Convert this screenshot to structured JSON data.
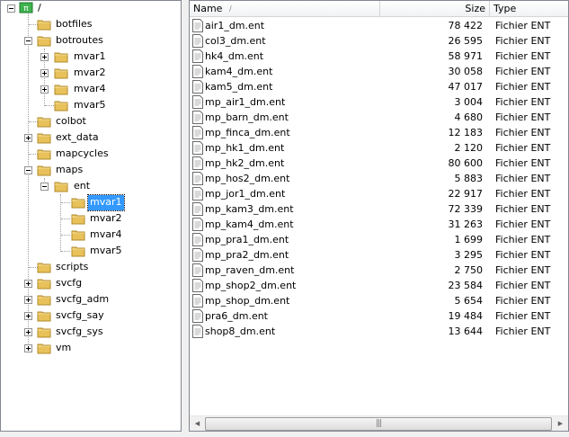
{
  "tree": {
    "root_label": "/",
    "items": [
      {
        "label": "botfiles"
      },
      {
        "label": "botroutes"
      },
      {
        "label": "mvar1"
      },
      {
        "label": "mvar2"
      },
      {
        "label": "mvar4"
      },
      {
        "label": "mvar5"
      },
      {
        "label": "colbot"
      },
      {
        "label": "ext_data"
      },
      {
        "label": "mapcycles"
      },
      {
        "label": "maps"
      },
      {
        "label": "ent"
      },
      {
        "label": "mvar1"
      },
      {
        "label": "mvar2"
      },
      {
        "label": "mvar4"
      },
      {
        "label": "mvar5"
      },
      {
        "label": "scripts"
      },
      {
        "label": "svcfg"
      },
      {
        "label": "svcfg_adm"
      },
      {
        "label": "svcfg_say"
      },
      {
        "label": "svcfg_sys"
      },
      {
        "label": "vm"
      }
    ],
    "selected_item": "mvar1"
  },
  "list": {
    "columns": {
      "name": "Name",
      "size": "Size",
      "type": "Type"
    },
    "files": [
      {
        "name": "air1_dm.ent",
        "size": "78 422",
        "type": "Fichier ENT"
      },
      {
        "name": "col3_dm.ent",
        "size": "26 595",
        "type": "Fichier ENT"
      },
      {
        "name": "hk4_dm.ent",
        "size": "58 971",
        "type": "Fichier ENT"
      },
      {
        "name": "kam4_dm.ent",
        "size": "30 058",
        "type": "Fichier ENT"
      },
      {
        "name": "kam5_dm.ent",
        "size": "47 017",
        "type": "Fichier ENT"
      },
      {
        "name": "mp_air1_dm.ent",
        "size": "3 004",
        "type": "Fichier ENT"
      },
      {
        "name": "mp_barn_dm.ent",
        "size": "4 680",
        "type": "Fichier ENT"
      },
      {
        "name": "mp_finca_dm.ent",
        "size": "12 183",
        "type": "Fichier ENT"
      },
      {
        "name": "mp_hk1_dm.ent",
        "size": "2 120",
        "type": "Fichier ENT"
      },
      {
        "name": "mp_hk2_dm.ent",
        "size": "80 600",
        "type": "Fichier ENT"
      },
      {
        "name": "mp_hos2_dm.ent",
        "size": "5 883",
        "type": "Fichier ENT"
      },
      {
        "name": "mp_jor1_dm.ent",
        "size": "22 917",
        "type": "Fichier ENT"
      },
      {
        "name": "mp_kam3_dm.ent",
        "size": "72 339",
        "type": "Fichier ENT"
      },
      {
        "name": "mp_kam4_dm.ent",
        "size": "31 263",
        "type": "Fichier ENT"
      },
      {
        "name": "mp_pra1_dm.ent",
        "size": "1 699",
        "type": "Fichier ENT"
      },
      {
        "name": "mp_pra2_dm.ent",
        "size": "3 295",
        "type": "Fichier ENT"
      },
      {
        "name": "mp_raven_dm.ent",
        "size": "2 750",
        "type": "Fichier ENT"
      },
      {
        "name": "mp_shop2_dm.ent",
        "size": "23 584",
        "type": "Fichier ENT"
      },
      {
        "name": "mp_shop_dm.ent",
        "size": "5 654",
        "type": "Fichier ENT"
      },
      {
        "name": "pra6_dm.ent",
        "size": "19 484",
        "type": "Fichier ENT"
      },
      {
        "name": "shop8_dm.ent",
        "size": "13 644",
        "type": "Fichier ENT"
      }
    ]
  },
  "colors": {
    "selection": "#3399ff",
    "border": "#828790",
    "folder": "#e8c15a"
  },
  "icons": {
    "root": "network-drive-icon",
    "folder": "folder-icon",
    "file": "document-icon"
  }
}
